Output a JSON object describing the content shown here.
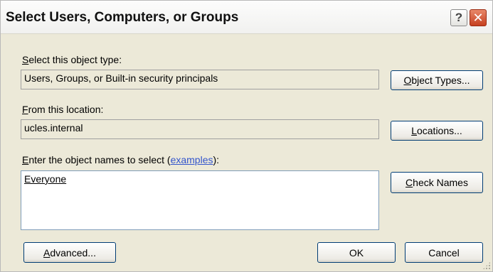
{
  "window": {
    "title": "Select Users, Computers, or Groups",
    "help_label": "?",
    "close_label": "✕"
  },
  "object_type": {
    "label_accel": "S",
    "label_rest": "elect this object type:",
    "value": "Users, Groups, or Built-in security principals",
    "button_accel": "O",
    "button_rest": "bject Types..."
  },
  "location": {
    "label_accel": "F",
    "label_rest": "rom this location:",
    "value": "ucles.internal",
    "button_accel": "L",
    "button_rest": "ocations..."
  },
  "names": {
    "label_accel": "E",
    "label_rest": "nter the object names to select (",
    "link_text": "examples",
    "label_end": "):",
    "value": "Everyone",
    "check_accel": "C",
    "check_rest": "heck Names"
  },
  "footer": {
    "advanced_accel": "A",
    "advanced_rest": "dvanced...",
    "ok_label": "OK",
    "cancel_label": "Cancel"
  }
}
